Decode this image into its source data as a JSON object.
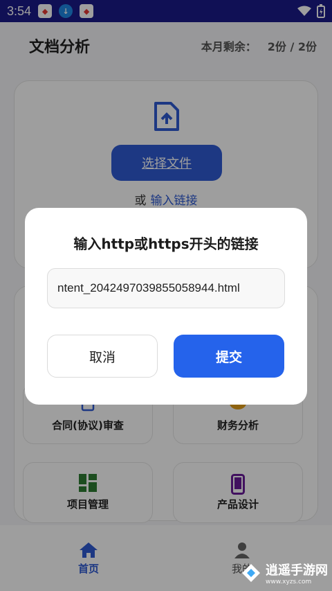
{
  "status_bar": {
    "time": "3:54"
  },
  "header": {
    "title": "文档分析",
    "quota_label": "本月剩余：",
    "quota_value": "2份 / 2份"
  },
  "upload": {
    "select_file_label": "选择文件",
    "or_label": "或",
    "link_label": "输入链接"
  },
  "categories": [
    {
      "label": "合同(协议)审查",
      "icon": "contract-icon"
    },
    {
      "label": "财务分析",
      "icon": "finance-icon"
    },
    {
      "label": "项目管理",
      "icon": "dashboard-icon"
    },
    {
      "label": "产品设计",
      "icon": "phone-icon"
    }
  ],
  "bottom_nav": {
    "home_label": "首页",
    "mine_label": "我的"
  },
  "dialog": {
    "title": "输入http或https开头的链接",
    "url_value": "ntent_2042497039855058944.html",
    "cancel_label": "取消",
    "submit_label": "提交"
  },
  "watermark": {
    "text": "逍遥手游网",
    "sub": "www.xyzs.com"
  },
  "colors": {
    "accent": "#2563eb",
    "status_bar": "#1a1a8a",
    "finance_icon": "#e6a11a",
    "dashboard_icon": "#2e7d32",
    "phone_icon": "#6a1b9a"
  }
}
